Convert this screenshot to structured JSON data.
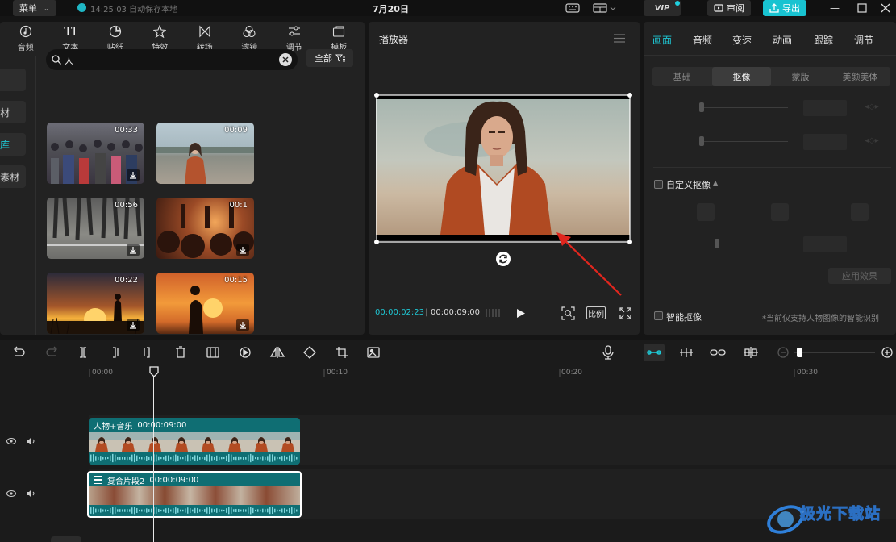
{
  "topbar": {
    "menu_label": "菜单",
    "save_status": "14:25:03 自动保存本地",
    "date": "7月20日",
    "vip_label": "VIP",
    "review_label": "审阅",
    "export_label": "导出"
  },
  "categories": [
    {
      "label": "音频",
      "icon": "music-icon"
    },
    {
      "label": "文本",
      "icon": "text-icon"
    },
    {
      "label": "贴纸",
      "icon": "sticker-icon"
    },
    {
      "label": "特效",
      "icon": "effects-icon"
    },
    {
      "label": "转场",
      "icon": "transition-icon"
    },
    {
      "label": "滤镜",
      "icon": "filter-icon"
    },
    {
      "label": "调节",
      "icon": "adjust-icon"
    },
    {
      "label": "模板",
      "icon": "template-icon"
    }
  ],
  "sidebar": {
    "items": [
      "",
      "材",
      "库",
      "素材"
    ]
  },
  "search": {
    "value": "人",
    "filter_label": "全部"
  },
  "media": [
    {
      "duration": "00:33",
      "scene": "crowd"
    },
    {
      "duration": "00:09",
      "scene": "beach-woman"
    },
    {
      "duration": "00:56",
      "scene": "street-feet"
    },
    {
      "duration": "00:1",
      "scene": "night-crowd"
    },
    {
      "duration": "00:22",
      "scene": "sunset-silhouette"
    },
    {
      "duration": "00:15",
      "scene": "sunset-walker"
    }
  ],
  "player": {
    "title": "播放器",
    "current_time": "00:00:02:23",
    "total_time": "00:00:09:00",
    "ratio_label": "比例"
  },
  "properties": {
    "tabs": [
      "画面",
      "音频",
      "变速",
      "动画",
      "跟踪",
      "调节"
    ],
    "active_tab": "画面",
    "sub_tabs": [
      "基础",
      "抠像",
      "蒙版",
      "美颜美体"
    ],
    "active_sub_tab": "抠像",
    "custom_matting_label": "自定义抠像",
    "apply_label": "应用效果",
    "smart_matting_label": "智能抠像",
    "smart_matting_note": "*当前仅支持人物图像的智能识别"
  },
  "timeline": {
    "ruler": [
      "00:00",
      "00:10",
      "00:20",
      "00:30"
    ],
    "clips": [
      {
        "name": "人物+音乐",
        "duration": "00:00:09:00"
      },
      {
        "name": "复合片段2",
        "duration": "00:00:09:00"
      }
    ]
  },
  "colors": {
    "accent": "#18c3d1",
    "clip_teal": "#0f6e73"
  },
  "watermark": "极光下载站"
}
